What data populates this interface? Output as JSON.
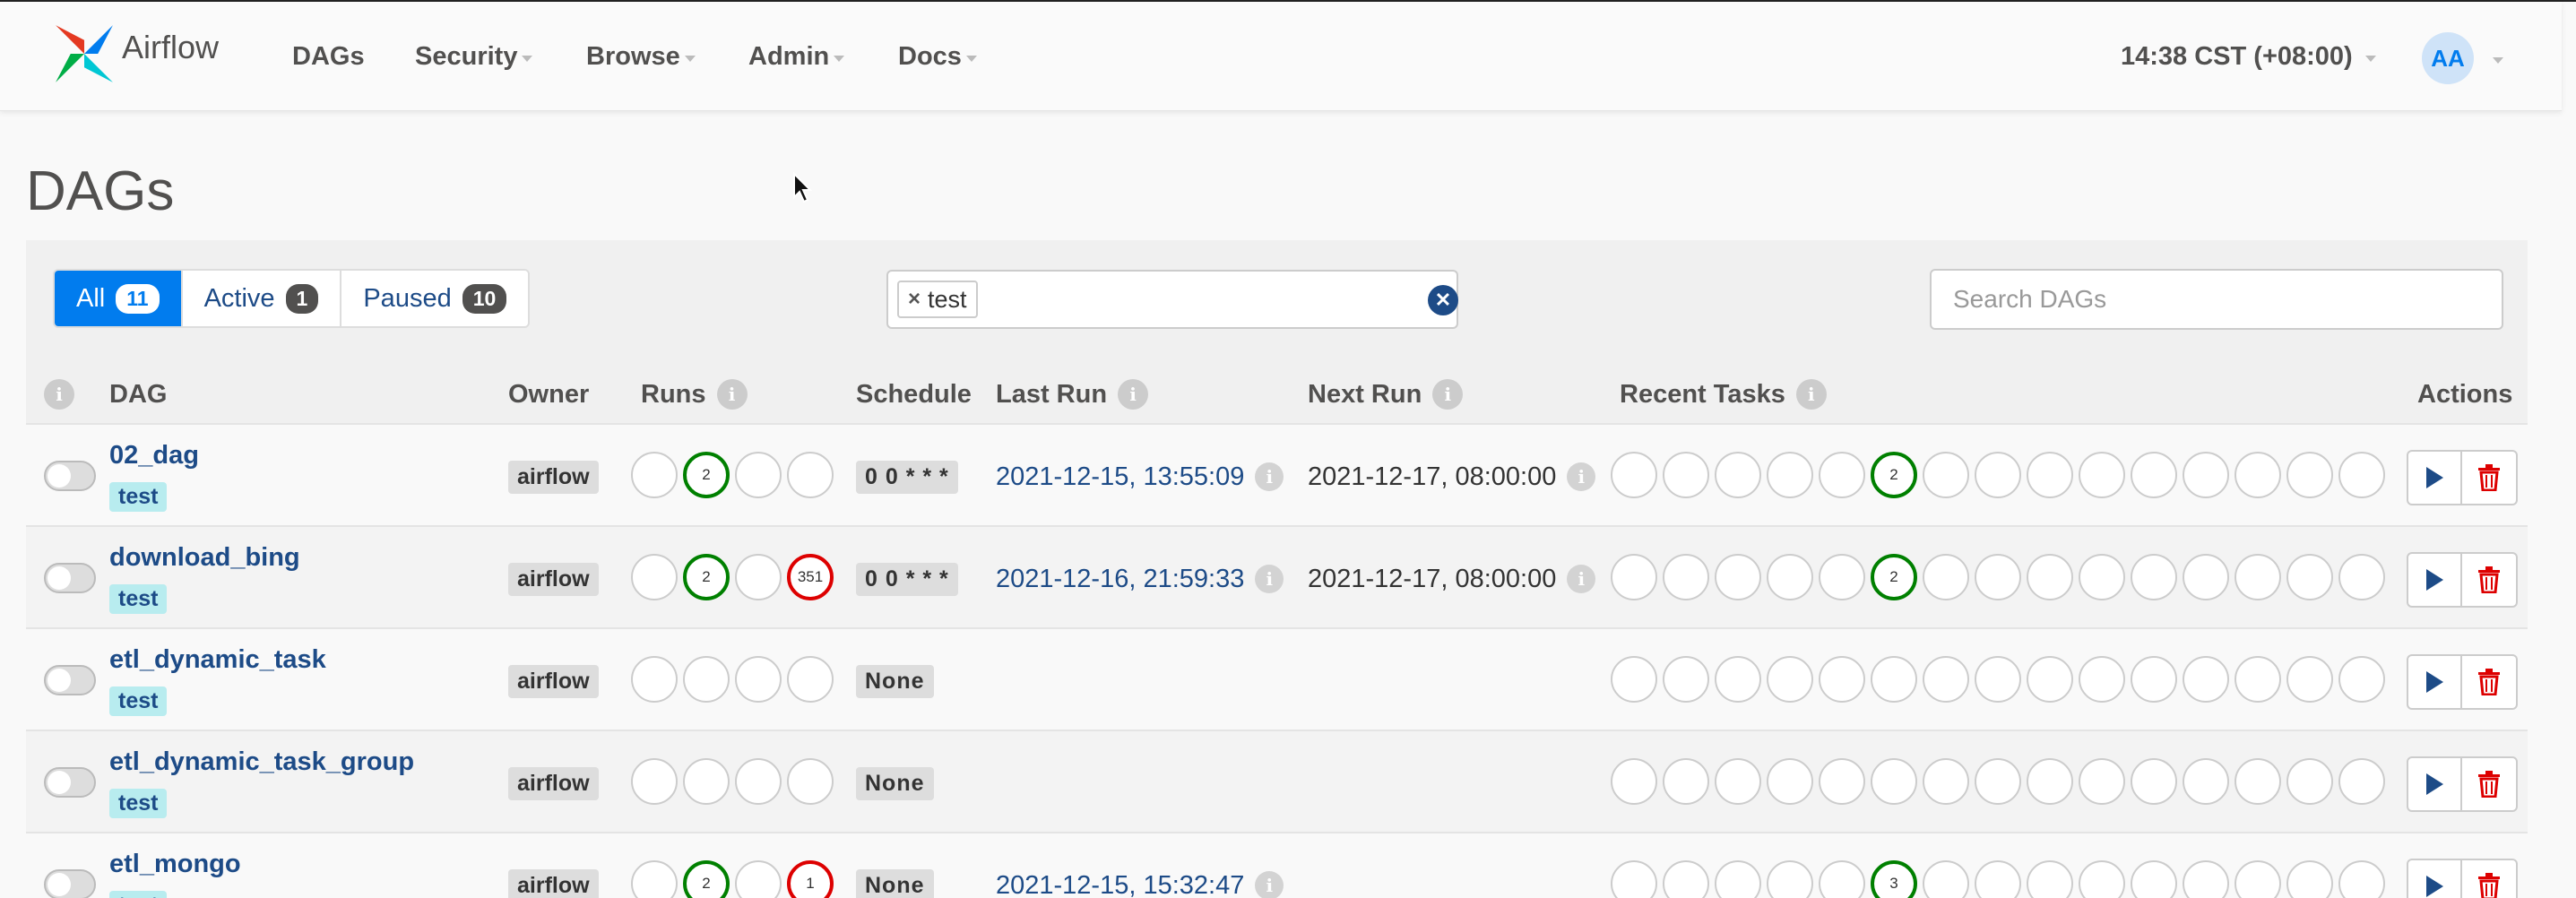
{
  "navbar": {
    "brand": "Airflow",
    "items": [
      {
        "label": "DAGs",
        "has_menu": false
      },
      {
        "label": "Security",
        "has_menu": true
      },
      {
        "label": "Browse",
        "has_menu": true
      },
      {
        "label": "Admin",
        "has_menu": true
      },
      {
        "label": "Docs",
        "has_menu": true
      }
    ],
    "time": "14:38 CST (+08:00)",
    "avatar_initials": "AA"
  },
  "page": {
    "title": "DAGs"
  },
  "filters": {
    "tabs": [
      {
        "label": "All",
        "count": "11",
        "active": true
      },
      {
        "label": "Active",
        "count": "1",
        "active": false
      },
      {
        "label": "Paused",
        "count": "10",
        "active": false
      }
    ],
    "tag_filter": {
      "selected_tag": "test"
    },
    "search_placeholder": "Search DAGs"
  },
  "table": {
    "headers": {
      "dag": "DAG",
      "owner": "Owner",
      "runs": "Runs",
      "schedule": "Schedule",
      "last_run": "Last Run",
      "next_run": "Next Run",
      "recent_tasks": "Recent Tasks",
      "actions": "Actions"
    },
    "rows": [
      {
        "name": "02_dag",
        "tag": "test",
        "owner": "airflow",
        "runs": [
          "",
          "2",
          "",
          ""
        ],
        "runs_state": [
          "none",
          "success",
          "none",
          "none"
        ],
        "schedule": "0 0 * * *",
        "last_run": "2021-12-15, 13:55:09",
        "next_run": "2021-12-17, 08:00:00",
        "tasks": [
          "",
          "",
          "",
          "",
          "",
          "2",
          "",
          "",
          "",
          "",
          "",
          "",
          "",
          "",
          ""
        ],
        "tasks_state": [
          "none",
          "none",
          "none",
          "none",
          "none",
          "success",
          "none",
          "none",
          "none",
          "none",
          "none",
          "none",
          "none",
          "none",
          "none"
        ]
      },
      {
        "name": "download_bing",
        "tag": "test",
        "owner": "airflow",
        "runs": [
          "",
          "2",
          "",
          "351"
        ],
        "runs_state": [
          "none",
          "success",
          "none",
          "failed"
        ],
        "schedule": "0 0 * * *",
        "last_run": "2021-12-16, 21:59:33",
        "next_run": "2021-12-17, 08:00:00",
        "tasks": [
          "",
          "",
          "",
          "",
          "",
          "2",
          "",
          "",
          "",
          "",
          "",
          "",
          "",
          "",
          ""
        ],
        "tasks_state": [
          "none",
          "none",
          "none",
          "none",
          "none",
          "success",
          "none",
          "none",
          "none",
          "none",
          "none",
          "none",
          "none",
          "none",
          "none"
        ]
      },
      {
        "name": "etl_dynamic_task",
        "tag": "test",
        "owner": "airflow",
        "runs": [
          "",
          "",
          "",
          ""
        ],
        "runs_state": [
          "none",
          "none",
          "none",
          "none"
        ],
        "schedule": "None",
        "last_run": "",
        "next_run": "",
        "tasks": [
          "",
          "",
          "",
          "",
          "",
          "",
          "",
          "",
          "",
          "",
          "",
          "",
          "",
          "",
          ""
        ],
        "tasks_state": [
          "none",
          "none",
          "none",
          "none",
          "none",
          "none",
          "none",
          "none",
          "none",
          "none",
          "none",
          "none",
          "none",
          "none",
          "none"
        ]
      },
      {
        "name": "etl_dynamic_task_group",
        "tag": "test",
        "owner": "airflow",
        "runs": [
          "",
          "",
          "",
          ""
        ],
        "runs_state": [
          "none",
          "none",
          "none",
          "none"
        ],
        "schedule": "None",
        "last_run": "",
        "next_run": "",
        "tasks": [
          "",
          "",
          "",
          "",
          "",
          "",
          "",
          "",
          "",
          "",
          "",
          "",
          "",
          "",
          ""
        ],
        "tasks_state": [
          "none",
          "none",
          "none",
          "none",
          "none",
          "none",
          "none",
          "none",
          "none",
          "none",
          "none",
          "none",
          "none",
          "none",
          "none"
        ]
      },
      {
        "name": "etl_mongo",
        "tag": "test",
        "owner": "airflow",
        "runs": [
          "",
          "2",
          "",
          "1"
        ],
        "runs_state": [
          "none",
          "success",
          "none",
          "failed"
        ],
        "schedule": "None",
        "last_run": "2021-12-15, 15:32:47",
        "next_run": "",
        "tasks": [
          "",
          "",
          "",
          "",
          "",
          "3",
          "",
          "",
          "",
          "",
          "",
          "",
          "",
          "",
          ""
        ],
        "tasks_state": [
          "none",
          "none",
          "none",
          "none",
          "none",
          "success",
          "none",
          "none",
          "none",
          "none",
          "none",
          "none",
          "none",
          "none",
          "none"
        ]
      }
    ]
  },
  "colors": {
    "accent": "#017cee",
    "link": "#1d4b87",
    "success": "#008000",
    "failed": "#dd0000",
    "tag_bg": "#b8ecef"
  },
  "icons": {
    "logo": "airflow-pinwheel-icon",
    "info": "info-icon",
    "trigger": "play-icon",
    "delete": "trash-icon",
    "clear": "close-circle-icon",
    "remove_tag": "close-icon"
  }
}
